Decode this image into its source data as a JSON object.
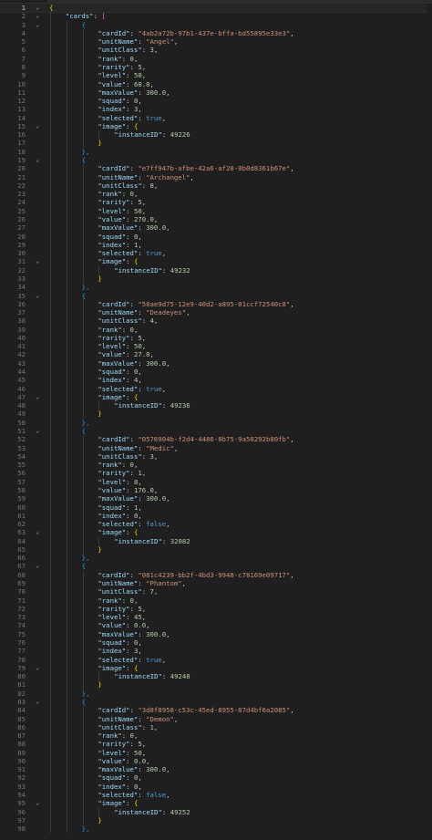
{
  "editor": {
    "language": "json",
    "active_line": 1,
    "fold_icon_name": "chevron-down-icon",
    "colors": {
      "background": "#1f1f1f",
      "key": "#9cdcfe",
      "string": "#ce9178",
      "number": "#b5cea8",
      "boolean": "#569cd6",
      "line_number": "#6e7681"
    }
  },
  "document": {
    "root_key": "cards",
    "cards": [
      {
        "cardId": "4ab2a72b-97b1-437e-bffa-bd55895e33e3",
        "unitName": "Angel",
        "unitClass": 3,
        "rank": 0,
        "rarity": 5,
        "level": 50,
        "value": "60.0",
        "maxValue": "300.0",
        "squad": 0,
        "index": 3,
        "selected": true,
        "instanceID": 49226
      },
      {
        "cardId": "e7ff947b-afbe-42a6-af28-0b0d8361b67e",
        "unitName": "Archangel",
        "unitClass": 8,
        "rank": 0,
        "rarity": 5,
        "level": 50,
        "value": "270.0",
        "maxValue": "300.0",
        "squad": 0,
        "index": 1,
        "selected": true,
        "instanceID": 49232
      },
      {
        "cardId": "58ae9d75-12e9-40d2-a895-01ccf72540c8",
        "unitName": "Deadeyes",
        "unitClass": 4,
        "rank": 0,
        "rarity": 5,
        "level": 50,
        "value": "27.0",
        "maxValue": "300.0",
        "squad": 0,
        "index": 4,
        "selected": true,
        "instanceID": 49236
      },
      {
        "cardId": "0576904b-f2d4-4486-8b75-9a50292b80fb",
        "unitName": "Medic",
        "unitClass": 3,
        "rank": 0,
        "rarity": 1,
        "level": 8,
        "value": "176.0",
        "maxValue": "300.0",
        "squad": 1,
        "index": 0,
        "selected": false,
        "instanceID": 32082
      },
      {
        "cardId": "081c4239-bb2f-4bd3-9948-c78169e09717",
        "unitName": "Phantom",
        "unitClass": 7,
        "rank": 0,
        "rarity": 5,
        "level": 45,
        "value": "0.0",
        "maxValue": "300.0",
        "squad": 0,
        "index": 3,
        "selected": true,
        "instanceID": 49248
      },
      {
        "cardId": "3d8f8958-c53c-45ed-8955-87d4bf6a2085",
        "unitName": "Demon",
        "unitClass": 1,
        "rank": 0,
        "rarity": 5,
        "level": 50,
        "value": "0.0",
        "maxValue": "300.0",
        "squad": 0,
        "index": 0,
        "selected": false,
        "instanceID": 49252
      }
    ]
  }
}
